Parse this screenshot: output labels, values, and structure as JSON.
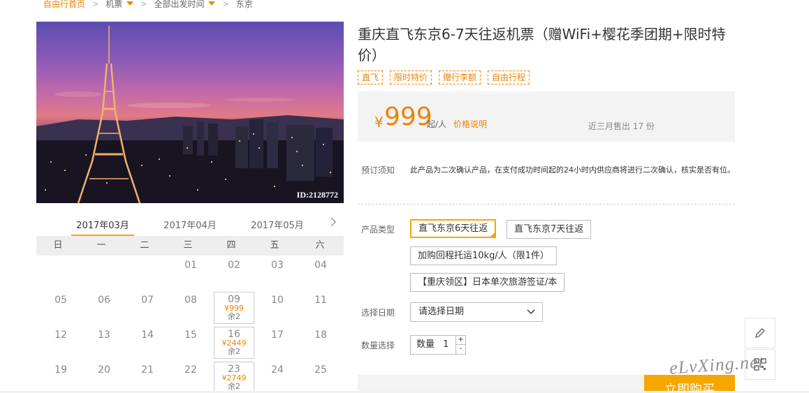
{
  "breadcrumb": {
    "home": "自由行首页",
    "category": "机票",
    "departure": "全部出发时间",
    "destination": "东京"
  },
  "photo": {
    "id_label": "ID:2128772"
  },
  "calendar": {
    "months": [
      "2017年03月",
      "2017年04月",
      "2017年05月"
    ],
    "active_month": "2017年03月",
    "weekdays": [
      "日",
      "一",
      "二",
      "三",
      "四",
      "五",
      "六"
    ],
    "weeks": [
      [
        {
          "d": ""
        },
        {
          "d": ""
        },
        {
          "d": ""
        },
        {
          "d": "01"
        },
        {
          "d": "02"
        },
        {
          "d": "03"
        },
        {
          "d": "04"
        }
      ],
      [
        {
          "d": "05"
        },
        {
          "d": "06"
        },
        {
          "d": "07"
        },
        {
          "d": "08"
        },
        {
          "d": "09",
          "price": "¥999",
          "remain": "余2"
        },
        {
          "d": "10"
        },
        {
          "d": "11"
        }
      ],
      [
        {
          "d": "12"
        },
        {
          "d": "13"
        },
        {
          "d": "14"
        },
        {
          "d": "15"
        },
        {
          "d": "16",
          "price": "¥2449",
          "remain": "余2"
        },
        {
          "d": "17"
        },
        {
          "d": "18"
        }
      ],
      [
        {
          "d": "19"
        },
        {
          "d": "20"
        },
        {
          "d": "21"
        },
        {
          "d": "22"
        },
        {
          "d": "23",
          "price": "¥2749",
          "remain": "余2"
        },
        {
          "d": "24"
        },
        {
          "d": "25"
        }
      ]
    ]
  },
  "product": {
    "title": "重庆直飞东京6-7天往返机票（赠WiFi+樱花季团期+限时特价）",
    "tags": [
      "直飞",
      "限时特价",
      "赠行李额",
      "自由行程"
    ],
    "price_currency": "¥",
    "price_value": "999",
    "price_unit": "起/人",
    "price_note_link": "价格说明",
    "sold_text": "近三月售出 17 份"
  },
  "booking": {
    "notice_label": "预订须知",
    "notice_text": "此产品为二次确认产品，在支付成功时间起的24小时内供应商将进行二次确认，核实是否有位。",
    "type_label": "产品类型",
    "options": [
      "直飞东京6天往返",
      "直飞东京7天往返",
      "加购回程托运10kg/人（限1件）",
      "【重庆领区】日本单次旅游签证/本"
    ],
    "selected_option": "直飞东京6天往返",
    "date_label": "选择日期",
    "date_placeholder": "请选择日期",
    "qty_label": "数量选择",
    "qty_prefix": "数量",
    "qty_value": "1",
    "qty_plus": "+",
    "qty_minus": "-",
    "buy_button": "立即购买"
  },
  "watermark": "eLvXing.net",
  "colors": {
    "accent": "#f08200",
    "button": "#f7a600"
  },
  "icons": {
    "edit": "pencil-icon",
    "qr": "qr-code-icon",
    "next": "chevron-right-icon",
    "dropdown": "chevron-down-icon"
  }
}
